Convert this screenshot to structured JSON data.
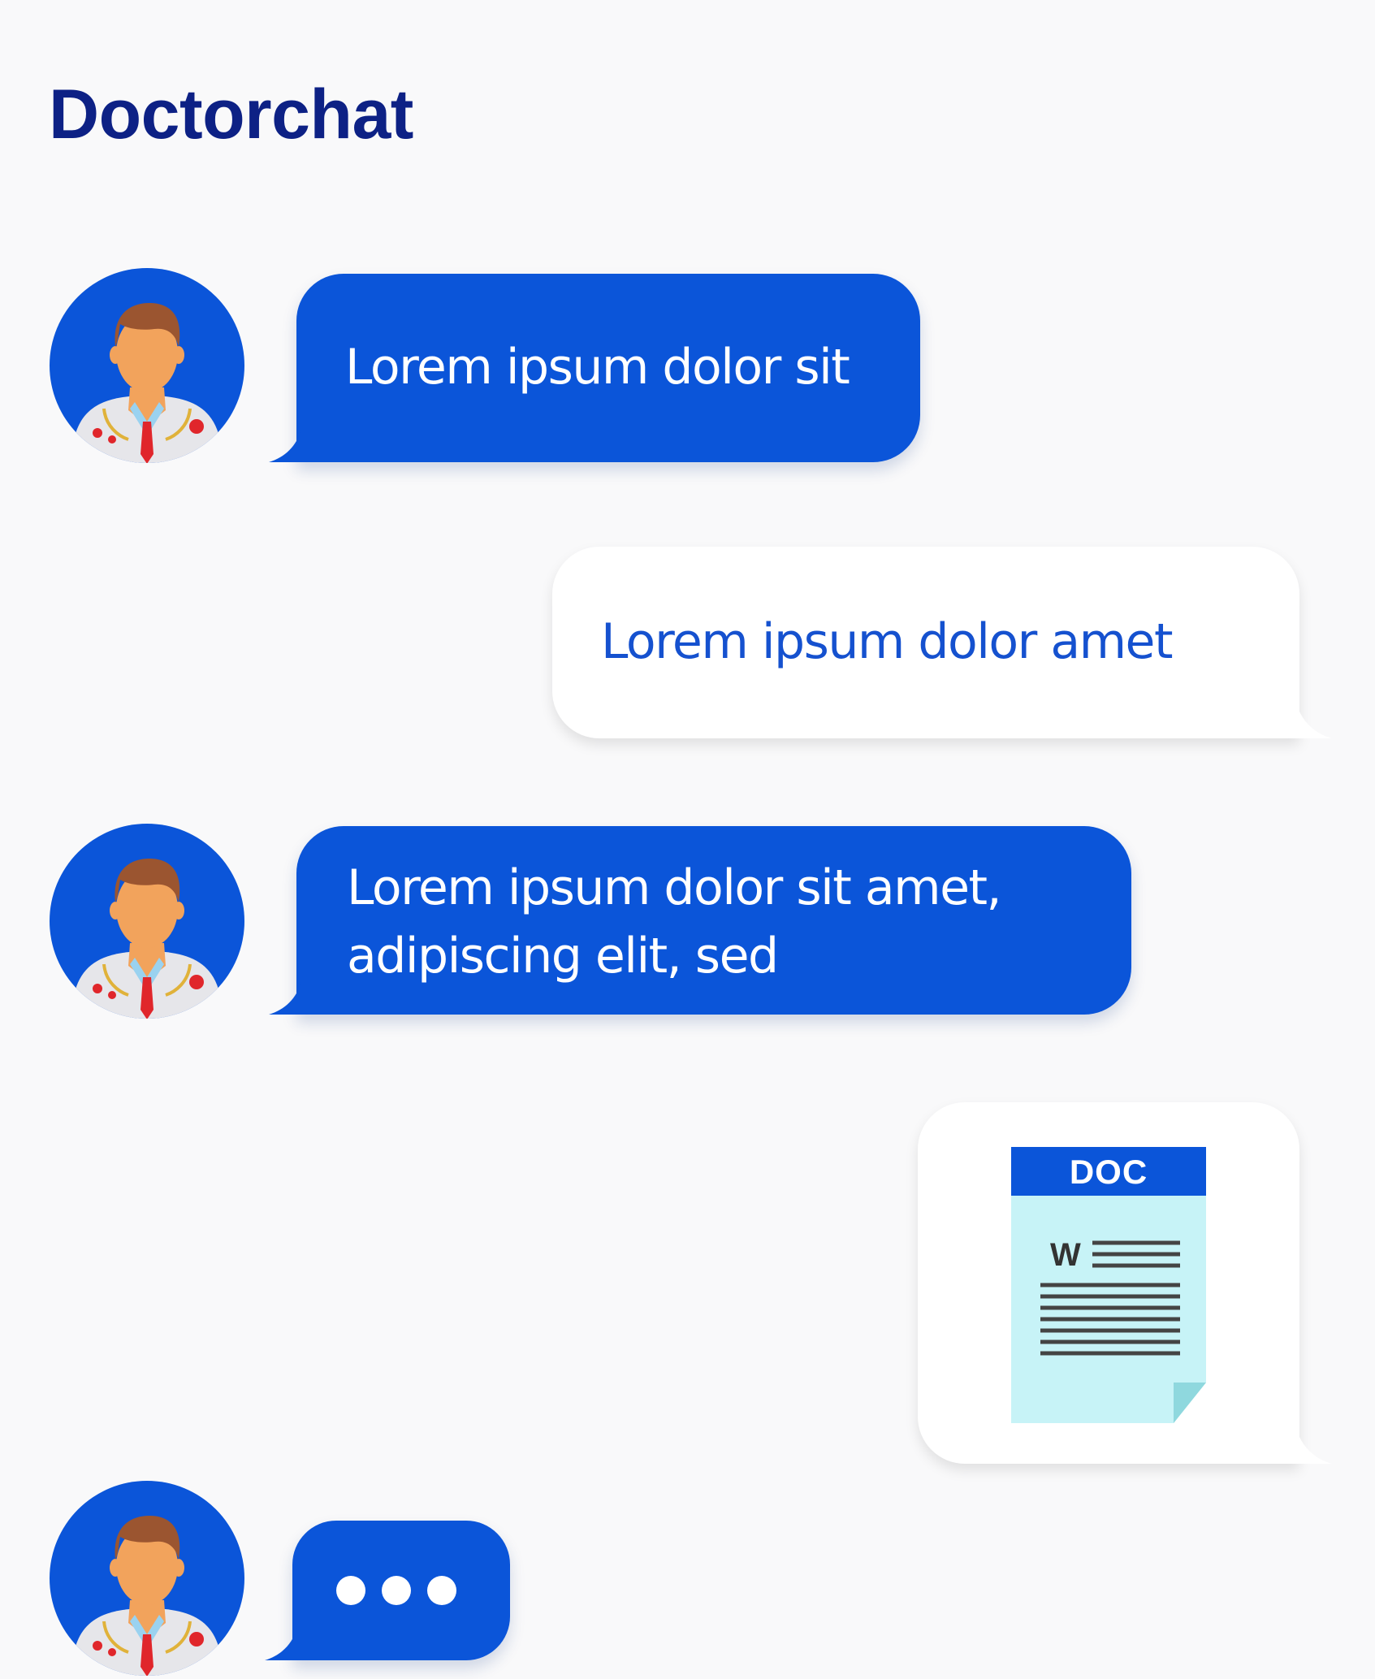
{
  "app": {
    "title": "Doctorchat"
  },
  "colors": {
    "title": "#0d2185",
    "doctor_bubble": "#0b55d9",
    "patient_bubble": "#ffffff",
    "patient_text": "#1551cf",
    "avatar_bg": "#0b55d9"
  },
  "messages": [
    {
      "sender": "doctor",
      "type": "text",
      "lines": [
        "Lorem ipsum dolor sit"
      ]
    },
    {
      "sender": "patient",
      "type": "text",
      "lines": [
        "Lorem ipsum dolor amet"
      ]
    },
    {
      "sender": "doctor",
      "type": "text",
      "lines": [
        "Lorem ipsum dolor sit amet,",
        "adipiscing elit, sed"
      ]
    },
    {
      "sender": "patient",
      "type": "attachment",
      "attachment": {
        "label": "DOC",
        "icon": "word-document-icon"
      }
    },
    {
      "sender": "doctor",
      "type": "typing",
      "icon": "typing-dots-icon"
    }
  ]
}
